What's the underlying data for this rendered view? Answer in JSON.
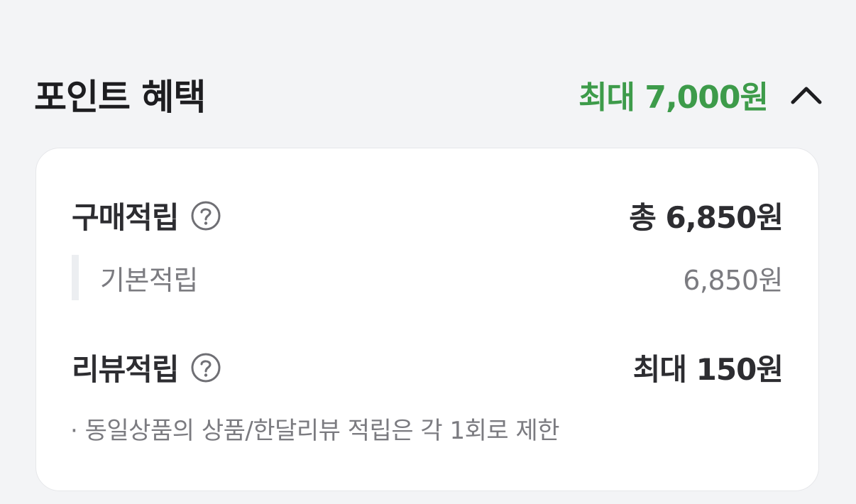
{
  "colors": {
    "accent_green": "#3d9b4a",
    "page_bg": "#f3f4f6",
    "card_bg": "#ffffff"
  },
  "header": {
    "title": "포인트 혜택",
    "max_label": "최대 7,000원",
    "toggle_icon": "chevron-up-icon"
  },
  "purchase": {
    "label": "구매적립",
    "help_icon": "question-circle-icon",
    "total": "총 6,850원",
    "basic": {
      "label": "기본적립",
      "value": "6,850원"
    }
  },
  "review": {
    "label": "리뷰적립",
    "help_icon": "question-circle-icon",
    "value": "최대 150원",
    "note": "· 동일상품의 상품/한달리뷰 적립은 각 1회로 제한"
  }
}
